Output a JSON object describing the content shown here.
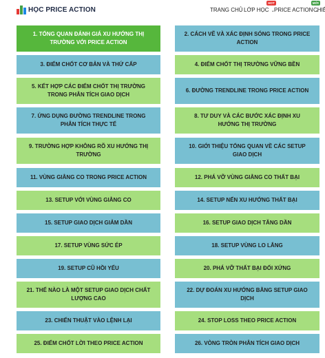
{
  "header": {
    "logo_text": "HỌC PRICE ACTION",
    "nav": [
      {
        "label": "TRANG CHỦ",
        "badge": ""
      },
      {
        "label": "LỚP HỌC",
        "badge": "HOT"
      },
      {
        "label": "PRICE ACTION",
        "badge": "MỚI"
      },
      {
        "label": "CHIẾ",
        "badge": ""
      }
    ],
    "caret": "⌄"
  },
  "lessons": [
    "1. TỔNG QUAN ĐÁNH GIÁ XU HƯỚNG THỊ TRƯỜNG VỚI PRICE ACTION",
    "2. CÁCH VẼ VÀ XÁC ĐỊNH SÓNG TRONG PRICE ACTION",
    "3. ĐIỂM CHỐT CƠ BẢN VÀ THỨ CẤP",
    "4. ĐIỂM CHỐT THỊ TRƯỜNG VỮNG BỀN",
    "5. KẾT HỢP CÁC ĐIỂM CHỐT THỊ TRƯỜNG TRONG PHÂN TÍCH GIAO DỊCH",
    "6. ĐƯỜNG TRENDLINE TRONG PRICE ACTION",
    "7. ỨNG DỤNG ĐƯỜNG TRENDLINE TRONG PHÂN TÍCH THỰC TẾ",
    "8. TƯ DUY VÀ CÁC BƯỚC XÁC ĐỊNH XU HƯỚNG THỊ TRƯỜNG",
    "9. TRƯỜNG HỢP KHÔNG RÕ XU HƯỚNG THỊ TRƯỜNG",
    "10. GIỚI THIỆU TỔNG QUAN VỀ CÁC SETUP GIAO DỊCH",
    "11. VÙNG GIẰNG CO TRONG PRICE ACTION",
    "12. PHÁ VỠ VÙNG GIẰNG CO THẤT BẠI",
    "13. SETUP VỚI VÙNG GIẰNG CO",
    "14. SETUP NẾN XU HƯỚNG THẤT BẠI",
    "15. SETUP GIAO DỊCH GIẢM DẦN",
    "16. SETUP GIAO DỊCH TĂNG DẦN",
    "17. SETUP VÙNG SỨC ÉP",
    "18. SETUP VÙNG LO LẮNG",
    "19. SETUP CŨ HỒI YẾU",
    "20. PHÁ VỠ THẤT BẠI ĐỐI XỨNG",
    "21. THẾ NÀO LÀ MỘT SETUP GIAO DỊCH CHẤT LƯỢNG CAO",
    "22. DỰ ĐOÁN XU HƯỚNG BẰNG SETUP GIAO DỊCH",
    "23. CHIẾN THUẬT VÀO LỆNH LẠI",
    "24. STOP LOSS THEO PRICE ACTION",
    "25. ĐIỂM CHỐT LỜI THEO PRICE ACTION",
    "26. VÒNG TRÒN PHÂN TÍCH GIAO DỊCH"
  ],
  "colors": {
    "active": "#56b73c",
    "green": "#a6de7e",
    "blue": "#78bfd2"
  }
}
